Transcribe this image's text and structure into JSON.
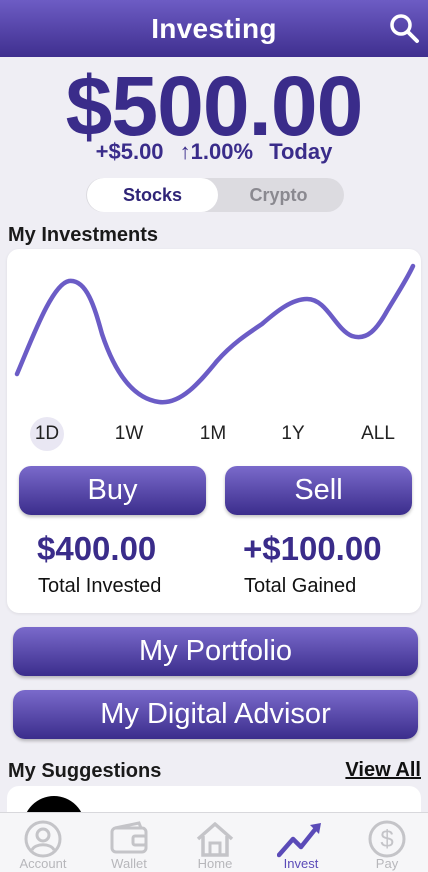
{
  "header": {
    "title": "Investing",
    "search_icon": "search-icon"
  },
  "balance": {
    "amount": "$500.00",
    "change_amount": "+$5.00",
    "change_percent": "↑1.00%",
    "period": "Today"
  },
  "asset_toggle": {
    "options": [
      "Stocks",
      "Crypto"
    ],
    "selected": "Stocks"
  },
  "investments": {
    "title": "My Investments",
    "ranges": [
      "1D",
      "1W",
      "1M",
      "1Y",
      "ALL"
    ],
    "selected_range": "1D",
    "buy_label": "Buy",
    "sell_label": "Sell",
    "total_invested": {
      "value": "$400.00",
      "label": "Total Invested"
    },
    "total_gained": {
      "value": "+$100.00",
      "label": "Total Gained"
    }
  },
  "actions": {
    "portfolio_label": "My Portfolio",
    "advisor_label": "My Digital Advisor"
  },
  "suggestions": {
    "title": "My Suggestions",
    "view_all_label": "View All"
  },
  "tabbar": {
    "items": [
      {
        "label": "Account",
        "icon": "account-icon"
      },
      {
        "label": "Wallet",
        "icon": "wallet-icon"
      },
      {
        "label": "Home",
        "icon": "home-icon"
      },
      {
        "label": "Invest",
        "icon": "invest-icon"
      },
      {
        "label": "Pay",
        "icon": "pay-icon"
      }
    ],
    "active": "Invest"
  },
  "colors": {
    "primary": "#3a2c8a",
    "accent": "#6a5acd",
    "line": "#6b5cc6"
  }
}
